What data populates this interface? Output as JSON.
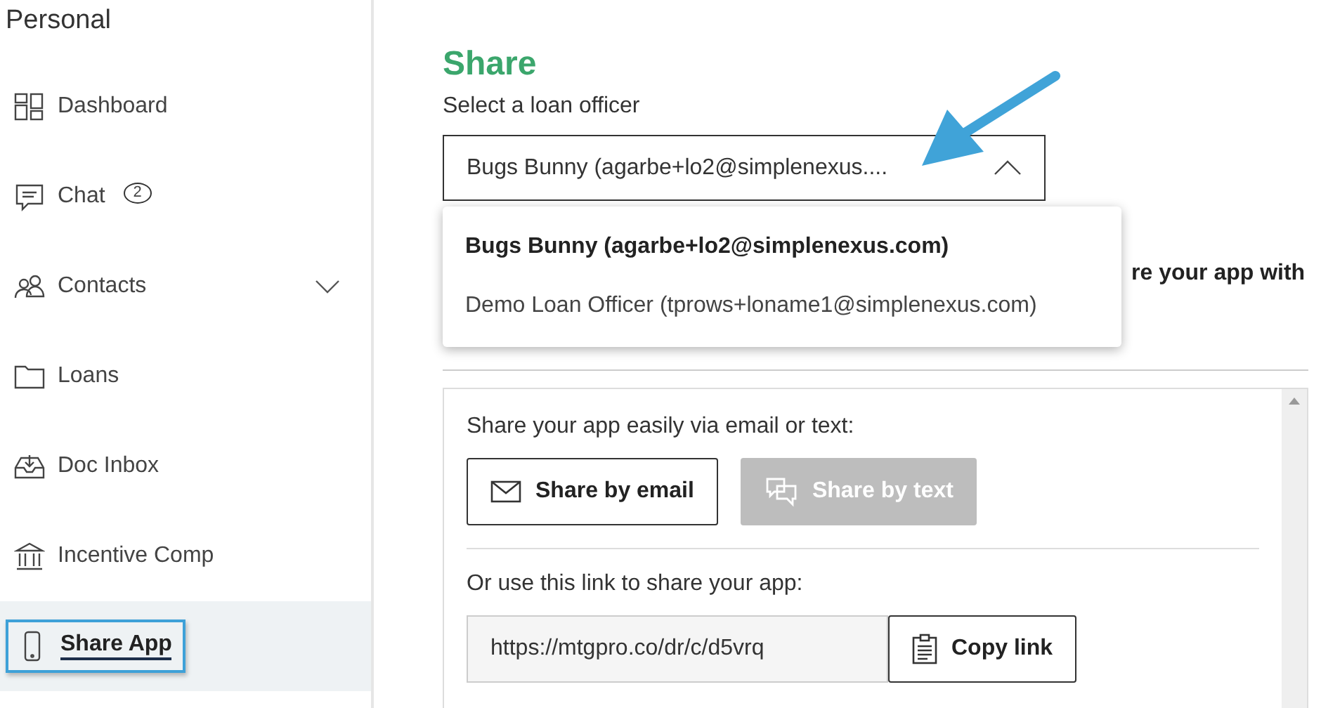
{
  "sidebar": {
    "title": "Personal",
    "items": [
      {
        "label": "Dashboard",
        "selected": false
      },
      {
        "label": "Chat",
        "badge": "2",
        "selected": false
      },
      {
        "label": "Contacts",
        "expandable": true,
        "selected": false
      },
      {
        "label": "Loans",
        "selected": false
      },
      {
        "label": "Doc Inbox",
        "selected": false
      },
      {
        "label": "Incentive Comp",
        "selected": false
      },
      {
        "label": "Share App",
        "selected": true
      }
    ]
  },
  "main": {
    "title": "Share",
    "select_label": "Select a loan officer",
    "select_value": "Bugs Bunny (agarbe+lo2@simplenexus....",
    "expanded": true,
    "options": [
      {
        "label": "Bugs Bunny (agarbe+lo2@simplenexus.com)",
        "selected": true
      },
      {
        "label": "Demo Loan Officer (tprows+loname1@simplenexus.com)",
        "selected": false
      }
    ],
    "hidden_text": "re your app with",
    "share_text": "Share your app easily via email or text:",
    "buttons": [
      {
        "label": "Share by email",
        "disabled": false
      },
      {
        "label": "Share by text",
        "disabled": true
      }
    ],
    "link_text": "Or use this link to share your app:",
    "link_value": "https://mtgpro.co/dr/c/d5vrq",
    "copy_button": "Copy link"
  }
}
